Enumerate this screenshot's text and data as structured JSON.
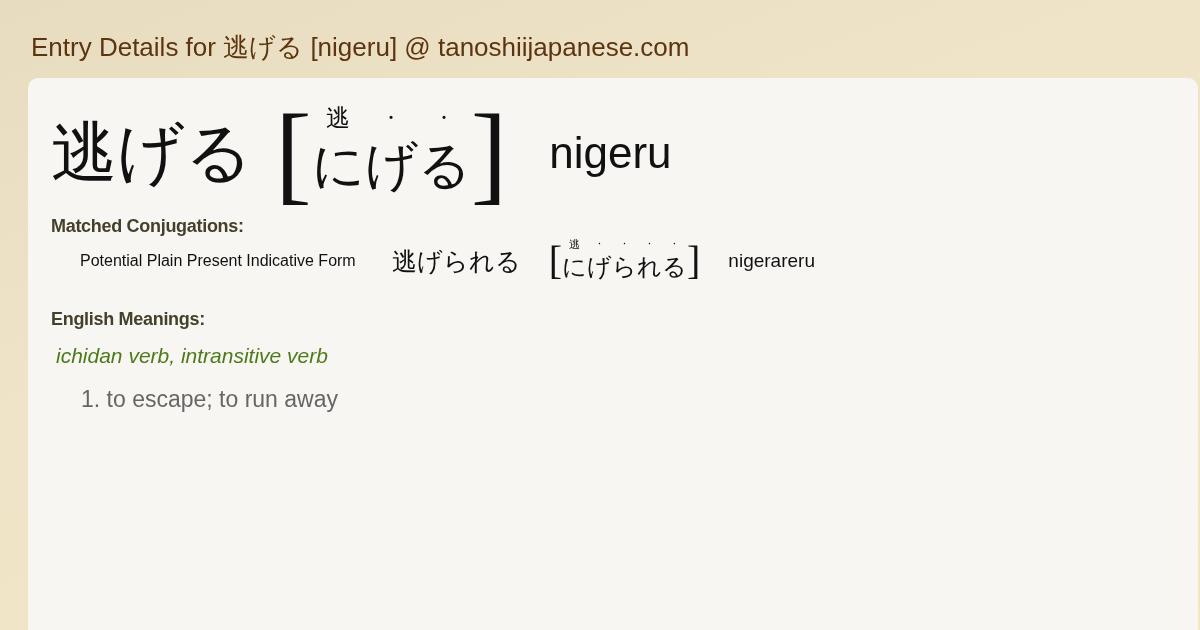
{
  "page_title": "Entry Details for 逃げる [nigeru] @ tanoshiijapanese.com",
  "entry": {
    "word": "逃げる",
    "open_bracket": "[",
    "reading": [
      {
        "kana": "に",
        "mark": "逃"
      },
      {
        "kana": "げ",
        "mark": "·"
      },
      {
        "kana": "る",
        "mark": "·"
      }
    ],
    "close_bracket": "]",
    "romaji": "nigeru"
  },
  "conjugations": {
    "heading": "Matched Conjugations:",
    "items": [
      {
        "form": "Potential Plain Present Indicative Form",
        "word": "逃げられる",
        "open_bracket": "[",
        "reading": [
          {
            "kana": "に",
            "mark": "逃"
          },
          {
            "kana": "げ",
            "mark": "·"
          },
          {
            "kana": "ら",
            "mark": "·"
          },
          {
            "kana": "れ",
            "mark": "·"
          },
          {
            "kana": "る",
            "mark": "·"
          }
        ],
        "close_bracket": "]",
        "romaji": "nigerareru"
      }
    ]
  },
  "meanings": {
    "heading": "English Meanings:",
    "part_of_speech": "ichidan verb, intransitive verb",
    "senses": [
      "1. to escape; to run away"
    ]
  }
}
